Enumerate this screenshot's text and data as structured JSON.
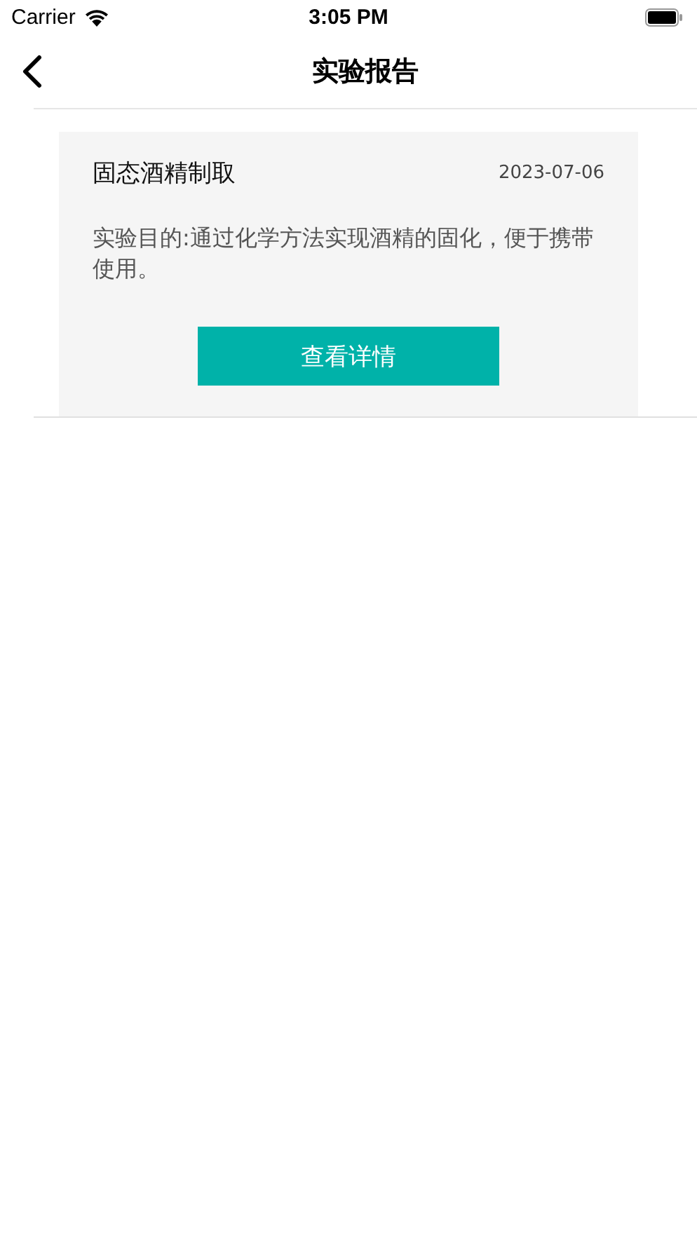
{
  "status_bar": {
    "carrier": "Carrier",
    "time": "3:05 PM"
  },
  "nav": {
    "title": "实验报告"
  },
  "reports": [
    {
      "title": "固态酒精制取",
      "date": "2023-07-06",
      "description": "实验目的:通过化学方法实现酒精的固化，便于携带使用。",
      "button": "查看详情"
    }
  ]
}
